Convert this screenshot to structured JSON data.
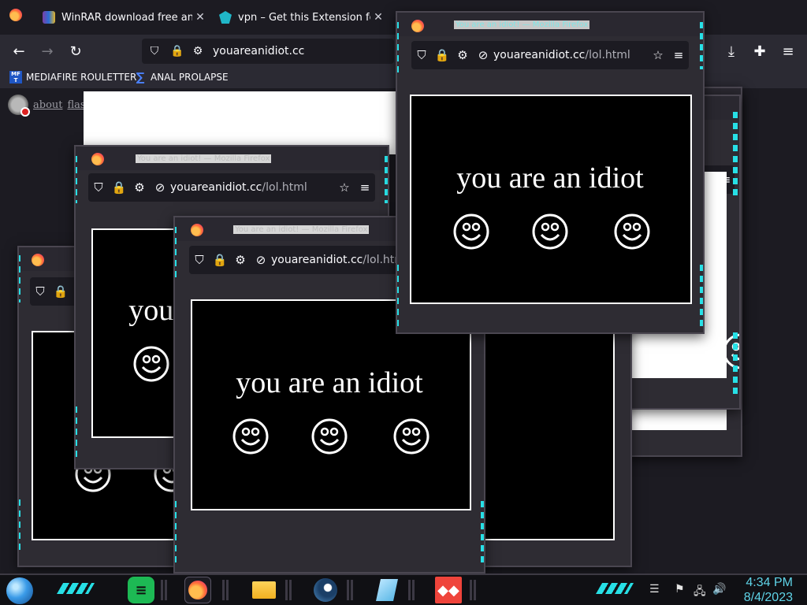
{
  "browser": {
    "tabs": [
      {
        "title": "WinRAR download free and sup",
        "close": "✕"
      },
      {
        "title": "vpn – Get this Extension for 🦊 F",
        "close": "✕"
      }
    ],
    "url": "youareanidiot.cc",
    "bookmarks": [
      {
        "label": "MEDIAFIRE ROULETTER",
        "icon_text": "MF T"
      },
      {
        "label": "ANAL PROLAPSE"
      }
    ],
    "page_links": [
      "about",
      "flash"
    ]
  },
  "popup": {
    "window_title": "You are an idiot! — Mozilla Firefox",
    "url_host": "youareanidiot.cc",
    "url_path": "/lol.html",
    "message": "you are an idiot"
  },
  "taskbar": {
    "time": "4:34 PM",
    "date": "8/4/2023",
    "apps": [
      "spotify",
      "firefox",
      "file-explorer",
      "steam",
      "notepad",
      "anydesk"
    ]
  },
  "colors": {
    "accent_cyan": "#27e0e6",
    "clock": "#5fd4e8",
    "popup_bg": "#000000"
  }
}
